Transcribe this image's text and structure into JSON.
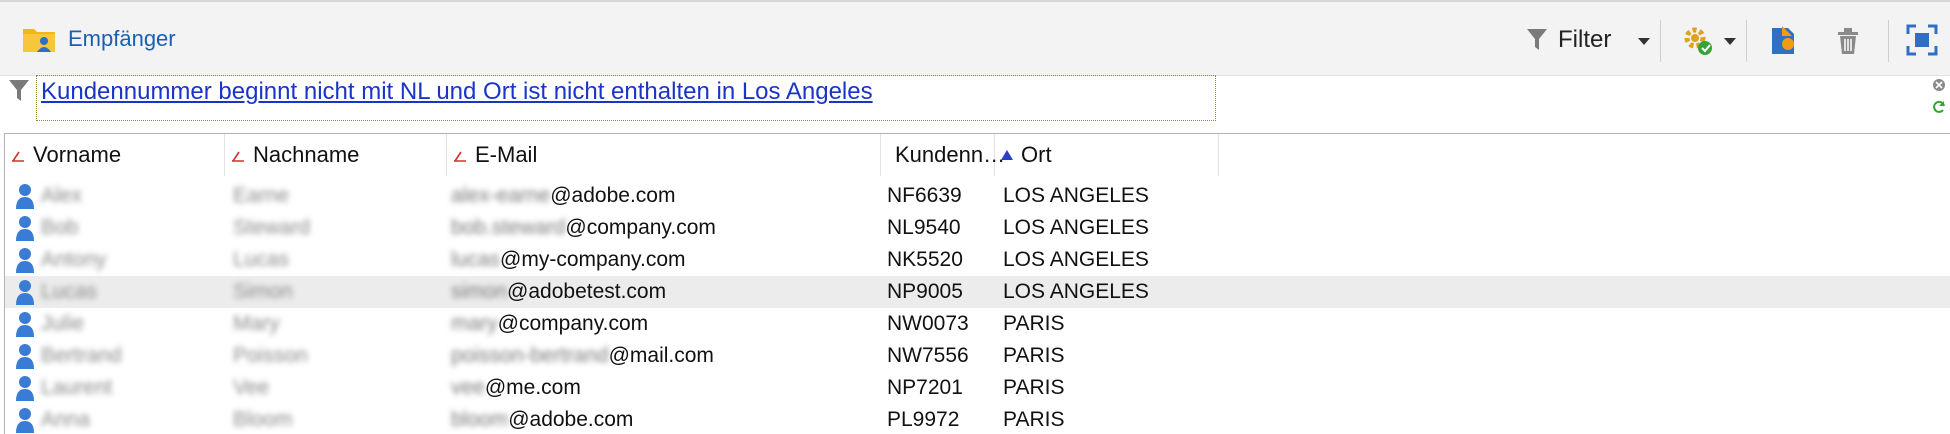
{
  "header": {
    "title": "Empfänger",
    "filter_label": "Filter"
  },
  "filter": {
    "text": "Kundennummer beginnt nicht mit NL und Ort ist nicht enthalten in Los Angeles"
  },
  "table": {
    "columns": [
      "Vorname",
      "Nachname",
      "E-Mail",
      "Kundenn…",
      "Ort"
    ],
    "rows": [
      {
        "first": "Alex",
        "last": "Earne",
        "mail_user": "alex-earne",
        "mail_domain": "@adobe.com",
        "customer": "NF6639",
        "city": "LOS ANGELES"
      },
      {
        "first": "Bob",
        "last": "Steward",
        "mail_user": "bob.steward",
        "mail_domain": "@company.com",
        "customer": "NL9540",
        "city": "LOS ANGELES"
      },
      {
        "first": "Antony",
        "last": "Lucas",
        "mail_user": "lucas",
        "mail_domain": "@my-company.com",
        "customer": "NK5520",
        "city": "LOS ANGELES"
      },
      {
        "first": "Lucas",
        "last": "Simon",
        "mail_user": "simon",
        "mail_domain": "@adobetest.com",
        "customer": "NP9005",
        "city": "LOS ANGELES"
      },
      {
        "first": "Julie",
        "last": "Mary",
        "mail_user": "mary",
        "mail_domain": "@company.com",
        "customer": "NW0073",
        "city": "PARIS"
      },
      {
        "first": "Bertrand",
        "last": "Poisson",
        "mail_user": "poisson-bertrand",
        "mail_domain": "@mail.com",
        "customer": "NW7556",
        "city": "PARIS"
      },
      {
        "first": "Laurent",
        "last": "Vee",
        "mail_user": "vee",
        "mail_domain": "@me.com",
        "customer": "NP7201",
        "city": "PARIS"
      },
      {
        "first": "Anna",
        "last": "Bloom",
        "mail_user": "bloom",
        "mail_domain": "@adobe.com",
        "customer": "PL9972",
        "city": "PARIS"
      }
    ]
  },
  "colors": {
    "title_blue": "#1b5fb4",
    "link_blue": "#1a34c8",
    "user_icon": "#3a7bd5",
    "gear": "#e0a020",
    "sort_red": "#d0312d"
  }
}
